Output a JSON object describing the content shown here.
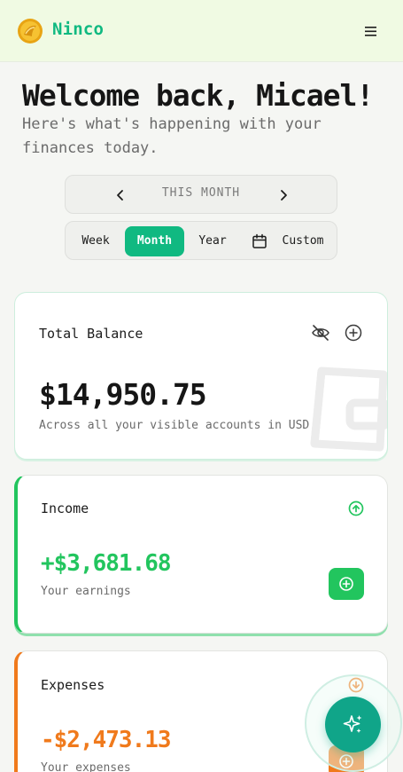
{
  "header": {
    "brand": "Ninco",
    "logo_icon": "coin-logo-icon",
    "menu_icon": "hamburger-menu-icon"
  },
  "welcome": {
    "title": "Welcome back, Micael!",
    "subtitle": "Here's what's happening with your finances today."
  },
  "period": {
    "label": "THIS MONTH",
    "prev_icon": "chevron-left-icon",
    "next_icon": "chevron-right-icon"
  },
  "range": {
    "options": [
      "Week",
      "Month",
      "Year",
      "Custom"
    ],
    "selected": "Month",
    "custom_icon": "calendar-icon"
  },
  "total_balance": {
    "title": "Total Balance",
    "amount": "$14,950.75",
    "subtitle": "Across all your visible accounts in USD",
    "hide_icon": "eye-off-icon",
    "add_icon": "plus-circle-icon"
  },
  "income": {
    "title": "Income",
    "amount": "+$3,681.68",
    "subtitle": "Your earnings",
    "trend_icon": "arrow-up-circle-icon",
    "color": "#22c55e"
  },
  "expenses": {
    "title": "Expenses",
    "amount": "-$2,473.13",
    "subtitle": "Your expenses",
    "trend_icon": "arrow-down-circle-icon",
    "color": "#f07a1c"
  },
  "fab": {
    "icon": "sparkles-icon",
    "color": "#10a589"
  }
}
